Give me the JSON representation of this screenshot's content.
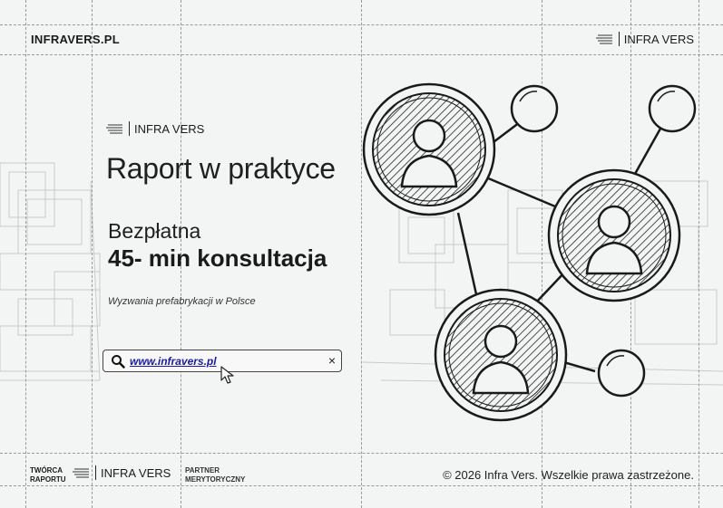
{
  "header": {
    "site": "INFRAVERS.PL",
    "brand": "INFRA VERS"
  },
  "hero": {
    "brand": "INFRA VERS",
    "title": "Raport w praktyce",
    "subtitle_line1": "Bezpłatna",
    "subtitle_line2": "45- min konsultacja",
    "description": "Wyzwania prefabrykacji w Polsce"
  },
  "search": {
    "url": "www.infravers.pl",
    "clear_label": "×"
  },
  "footer": {
    "creator_line1": "TWÓRCA",
    "creator_line2": "RAPORTU",
    "brand": "INFRA VERS",
    "partner_line1": "PARTNER",
    "partner_line2": "MERYTORYCZNY",
    "copyright": "© 2026 Infra Vers. Wszelkie prawa zastrzeżone."
  },
  "icons": {
    "logo": "infra-vers-logo-icon",
    "search": "search-icon",
    "clear": "close-icon",
    "cursor": "mouse-cursor-icon",
    "network": "people-network-icon"
  }
}
